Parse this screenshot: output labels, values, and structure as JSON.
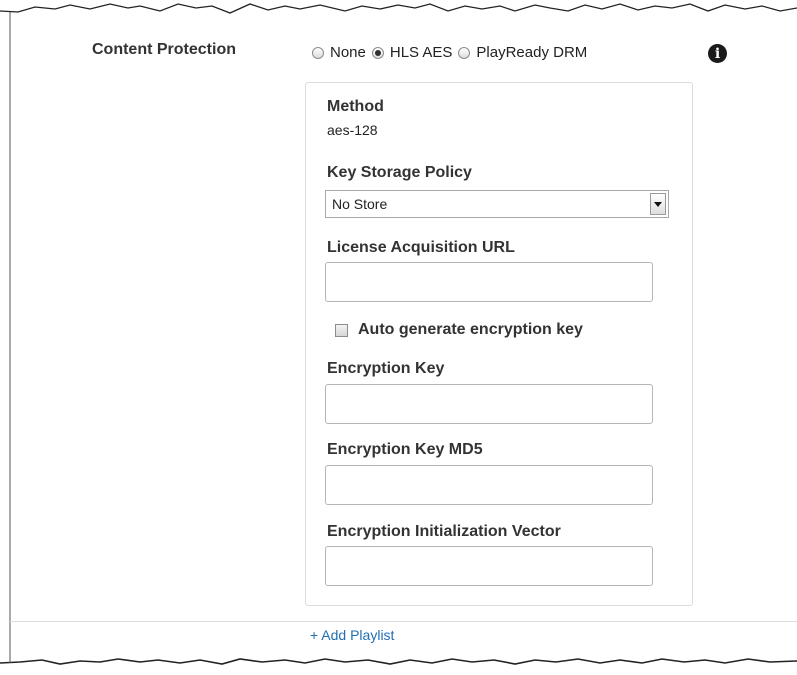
{
  "content_protection": {
    "label": "Content Protection",
    "options": [
      {
        "label": "None",
        "checked": false
      },
      {
        "label": "HLS AES",
        "checked": true
      },
      {
        "label": "PlayReady DRM",
        "checked": false
      }
    ],
    "info_icon": "info-icon"
  },
  "panel": {
    "method": {
      "label": "Method",
      "value": "aes-128"
    },
    "key_storage_policy": {
      "label": "Key Storage Policy",
      "selected": "No Store"
    },
    "license_acquisition_url": {
      "label": "License Acquisition URL",
      "value": ""
    },
    "auto_generate": {
      "label": "Auto generate encryption key",
      "checked": false
    },
    "encryption_key": {
      "label": "Encryption Key",
      "value": ""
    },
    "encryption_key_md5": {
      "label": "Encryption Key MD5",
      "value": ""
    },
    "encryption_iv": {
      "label": "Encryption Initialization Vector",
      "value": ""
    }
  },
  "footer": {
    "add_playlist": "+ Add Playlist"
  },
  "colors": {
    "link": "#1f6fb2",
    "label": "#333333",
    "border": "#dddddd"
  }
}
